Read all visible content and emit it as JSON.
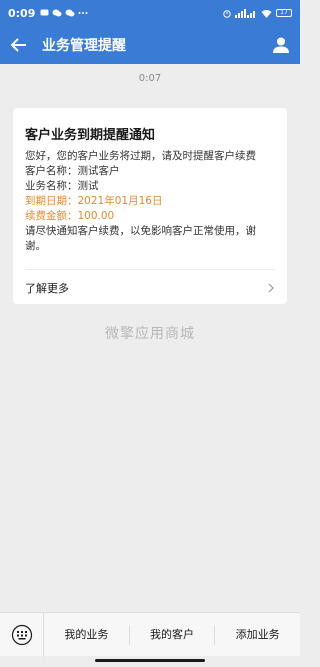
{
  "status_bar": {
    "time": "0:09",
    "left_icons": [
      "message-icon",
      "wechat-icon",
      "wechat-icon",
      "more-dots-icon"
    ],
    "signal_text": "4G 4G",
    "battery": "17"
  },
  "nav": {
    "title": "业务管理提醒"
  },
  "message": {
    "time": "0:07"
  },
  "card": {
    "title": "客户业务到期提醒通知",
    "intro": "您好，您的客户业务将过期，请及时提醒客户续费",
    "customer": "客户名称：测试客户",
    "business": "业务名称：测试",
    "due_date": "到期日期：2021年01月16日",
    "amount": "续费金额：100.00",
    "note": "请尽快通知客户续费，以免影响客户正常使用，谢谢。",
    "more_label": "了解更多"
  },
  "watermark": "微擎应用商城",
  "bottom_menu": {
    "items": [
      "我的业务",
      "我的客户",
      "添加业务"
    ]
  },
  "colors": {
    "accent": "#3a7bd5",
    "highlight": "#e6892e"
  }
}
